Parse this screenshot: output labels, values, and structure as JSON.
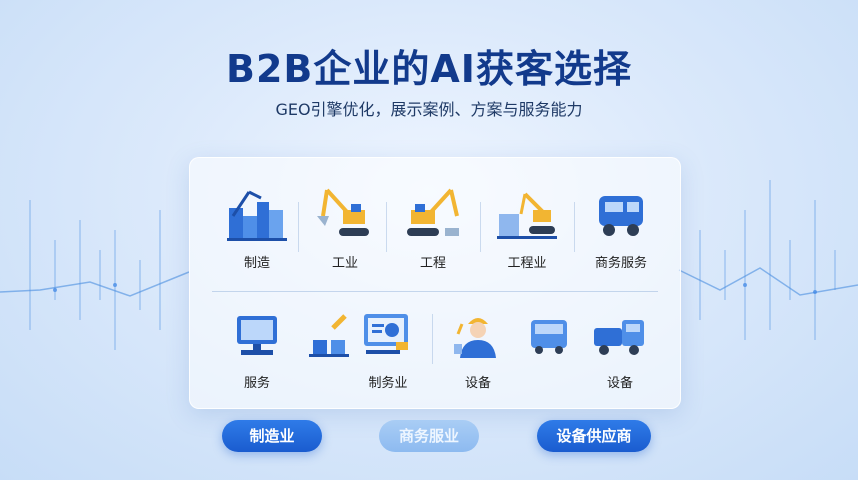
{
  "title": "B2B企业的AI获客选择",
  "subtitle": "GEO引擎优化，展示案例、方案与服务能力",
  "row1": [
    {
      "label": "制造",
      "icon": "factory-icon"
    },
    {
      "label": "工业",
      "icon": "excavator-icon"
    },
    {
      "label": "工程",
      "icon": "excavator-icon"
    },
    {
      "label": "工程业",
      "icon": "crane-building-icon"
    },
    {
      "label": "商务服务",
      "icon": "truck-icon"
    }
  ],
  "row2": [
    {
      "label": "服务",
      "icon": "computer-icon"
    },
    {
      "label": "",
      "icon": "pencil-desk-icon"
    },
    {
      "label": "制务业",
      "icon": "monitor-chart-icon"
    },
    {
      "label": "设备",
      "icon": "engineer-icon"
    },
    {
      "label": "",
      "icon": "bus-icon"
    },
    {
      "label": "设备",
      "icon": "tow-truck-icon"
    }
  ],
  "buttons": [
    {
      "label": "制造业",
      "style": "primary"
    },
    {
      "label": "商务服业",
      "style": "ghost"
    },
    {
      "label": "设备供应商",
      "style": "primary"
    }
  ],
  "colors": {
    "title": "#123a8c",
    "primary": "#1a5ccf",
    "machine": "#f2b532",
    "icon_blue": "#2f6fd6"
  }
}
